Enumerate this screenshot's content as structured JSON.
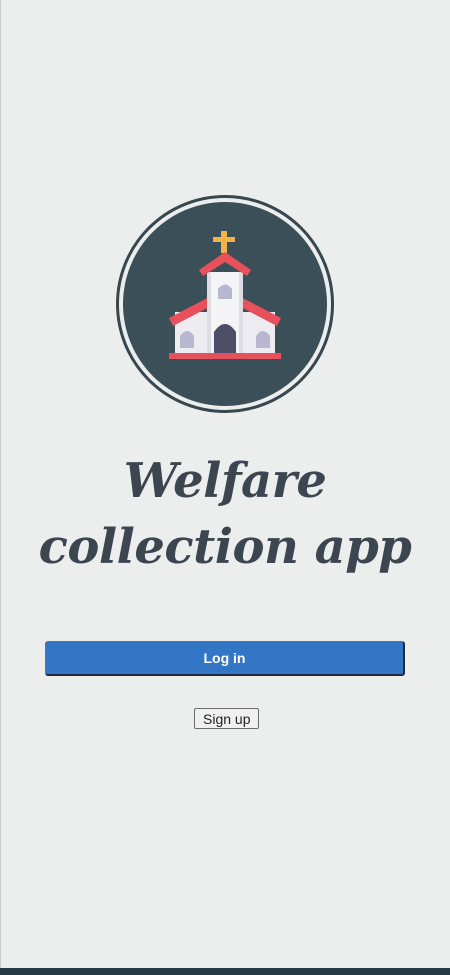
{
  "app": {
    "title": "Welfare collection app",
    "logo_icon": "church-icon"
  },
  "actions": {
    "login_label": "Log in",
    "signup_label": "Sign up"
  },
  "colors": {
    "background": "#eceeee",
    "logo_circle": "#3b4f59",
    "primary_button": "#3476c6",
    "title_text": "#3d4650",
    "church_roof": "#e8505b",
    "cross": "#f2b34a",
    "bottom_bar": "#243845"
  }
}
